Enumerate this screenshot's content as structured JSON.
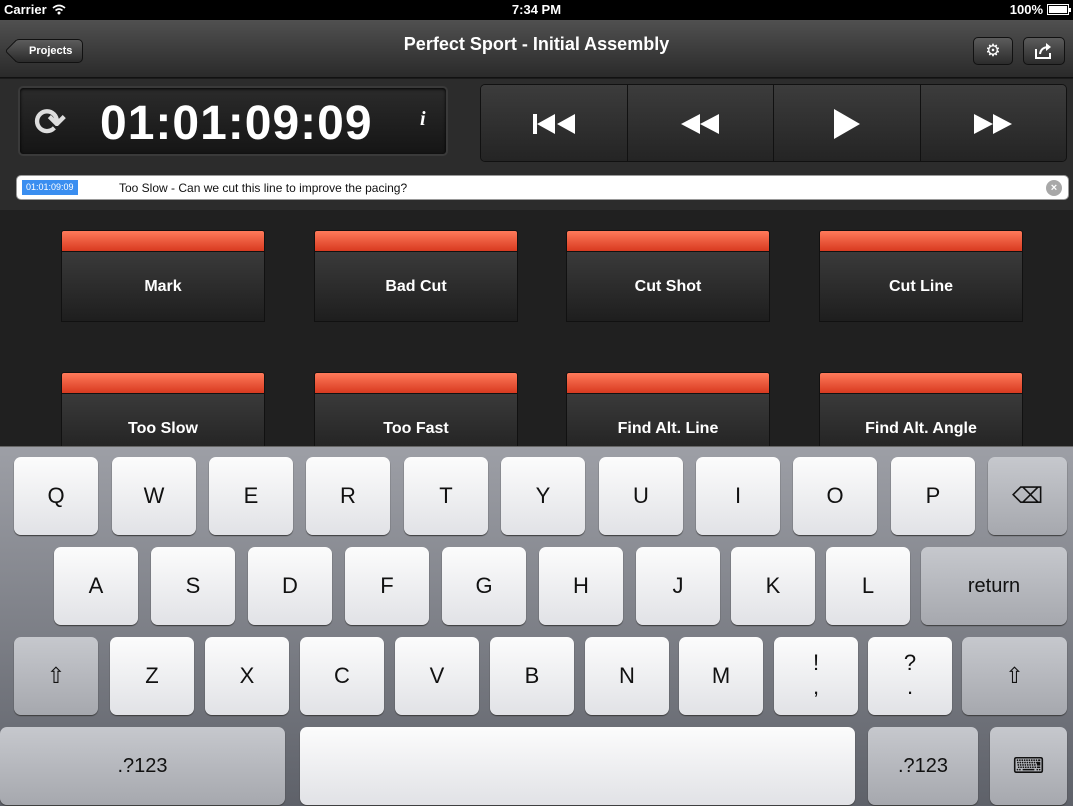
{
  "status_bar": {
    "carrier": "Carrier",
    "time": "7:34 PM",
    "battery": "100%"
  },
  "nav": {
    "back_label": "Projects",
    "title": "Perfect Sport - Initial Assembly",
    "settings_icon": "⚙",
    "share_icon": "⇪"
  },
  "timecode": {
    "value": "01:01:09:09",
    "info": "i",
    "sync_icon": "⟳"
  },
  "transport": {
    "to_start": "⏮",
    "rewind": "◀◀",
    "play": "▶",
    "fast_forward": "▶▶"
  },
  "note": {
    "timestamp": "01:01:09:09",
    "text": "Too Slow - Can we cut this line to improve the pacing?",
    "clear": "×"
  },
  "quick_notes": [
    "Mark",
    "Bad Cut",
    "Cut Shot",
    "Cut Line",
    "Too Slow",
    "Too Fast",
    "Find Alt. Line",
    "Find Alt. Angle"
  ],
  "keyboard": {
    "row1": [
      "Q",
      "W",
      "E",
      "R",
      "T",
      "Y",
      "U",
      "I",
      "O",
      "P"
    ],
    "backspace": "⌫",
    "row2": [
      "A",
      "S",
      "D",
      "F",
      "G",
      "H",
      "J",
      "K",
      "L"
    ],
    "return": "return",
    "shift": "⇧",
    "row3": [
      "Z",
      "X",
      "C",
      "V",
      "B",
      "N",
      "M"
    ],
    "punct1_top": "!",
    "punct1_bottom": ",",
    "punct2_top": "?",
    "punct2_bottom": ".",
    "numbers": ".?123",
    "hide_keyboard_icon": "⌨"
  }
}
